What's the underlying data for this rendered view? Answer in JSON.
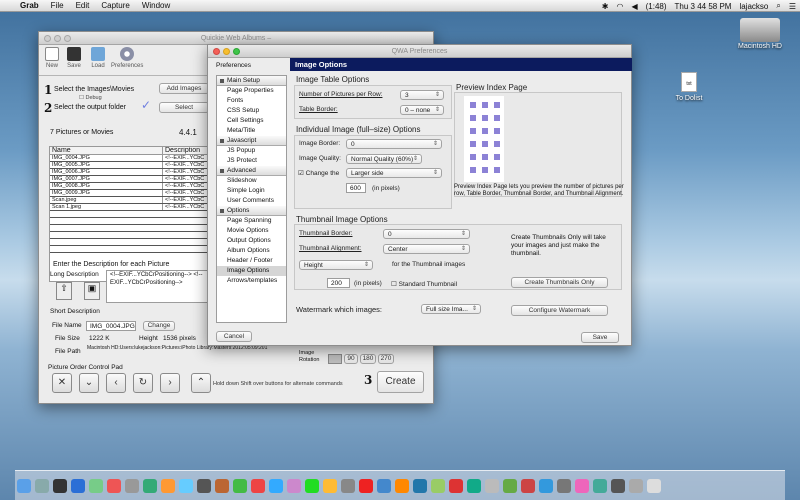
{
  "menubar": {
    "app": "Grab",
    "items": [
      "File",
      "Edit",
      "Capture",
      "Window"
    ],
    "battery": "(1:48)",
    "clock": "Thu 3 44 58 PM",
    "user": "lajackso"
  },
  "desktop": {
    "hd_label": "Macintosh HD",
    "file_ext": "txt",
    "file_label": "To Dolist"
  },
  "main": {
    "title": "Quickie Web Albums –",
    "toolbar": [
      "New",
      "Save",
      "Load",
      "Preferences"
    ],
    "step1": "Select the Images\\Movies",
    "step1_sub": "Debug",
    "add_images": "Add Images",
    "step2": "Select the output folder",
    "select_btn": "Select",
    "count": "7 Pictures or Movies",
    "version": "4.4.1",
    "table": {
      "headers": [
        "Name",
        "Description"
      ],
      "rows": [
        [
          "IMG_0004.JPG",
          "<!--EXIF...YCbC"
        ],
        [
          "IMG_0005.JPG",
          "<!--EXIF...YCbC"
        ],
        [
          "IMG_0006.JPG",
          "<!--EXIF...YCbC"
        ],
        [
          "IMG_0007.JPG",
          "<!--EXIF...YCbC"
        ],
        [
          "IMG_0008.JPG",
          "<!--EXIF...YCbC"
        ],
        [
          "IMG_0009.JPG",
          "<!--EXIF...YCbC"
        ],
        [
          "Scan.jpeg",
          "<!--EXIF...YCbC"
        ],
        [
          "Scan 1.jpeg",
          "<!--EXIF...YCbC"
        ]
      ]
    },
    "desc_header": "Enter  the Description for each Picture",
    "long_desc_label": "Long Description",
    "long_desc_value": "<!--EXIF...YCbCrPositioning-->  <!--EXIF...YCbCrPositioning-->",
    "short_desc_label": "Short Description",
    "file_name_label": "File Name",
    "file_name_value": "IMG_0004.JPG",
    "change": "Change",
    "file_size_label": "File Size",
    "file_size_value": "1222 K",
    "height_label": "Height",
    "height_value": "1536 pixels",
    "file_path_label": "File Path",
    "file_path_value": "Macintosh HD:Users:lukejackson:Pictures:iPhoto Library:Masters:2012:05:09:201",
    "image_rotation_label": "Image Rotation",
    "rotations": [
      "90",
      "180",
      "270"
    ],
    "pad_label": "Picture Order Control Pad",
    "hint": "Hold down Shift over buttons for alternate commands",
    "create_btn": "Create",
    "step3": "3"
  },
  "prefs": {
    "title": "QWA Preferences",
    "list_header": "Preferences",
    "bar": "Image Options",
    "groups": [
      {
        "h": "Main Setup",
        "items": [
          "Page Properties",
          "Fonts",
          "CSS Setup",
          "Cell Settings",
          "Meta/Title"
        ]
      },
      {
        "h": "Javascript",
        "items": [
          "JS Popup",
          "JS Protect"
        ]
      },
      {
        "h": "Advanced",
        "items": [
          "Slideshow",
          "Simple Login",
          "User Comments"
        ]
      },
      {
        "h": "Options",
        "items": [
          "Page Spanning",
          "Movie Options",
          "Output Options",
          "Album Options",
          "Header / Footer",
          "Image Options",
          "Arrows/templates"
        ]
      }
    ],
    "selected_item": "Image Options",
    "table_opts": {
      "title": "Image Table Options",
      "npr_label": "Number of Pictures per Row:",
      "npr_value": "3",
      "border_label": "Table Border:",
      "border_value": "0 – none"
    },
    "indiv": {
      "title": "Individual Image (full–size) Options",
      "border_label": "Image Border:",
      "border_value": "0",
      "quality_label": "Image Quality:",
      "quality_value": "Normal Quality (60%)",
      "change_label": "Change the",
      "change_value": "Larger side",
      "px_value": "600",
      "px_label": "(in pixels)"
    },
    "preview": {
      "title": "Preview Index Page",
      "text": "Preview Index Page lets you preview the number of pictures per row, Table Border, Thumbnail Border, and Thumbnail Alignment."
    },
    "thumb": {
      "title": "Thumbnail Image Options",
      "border_label": "Thumbnail Border:",
      "border_value": "0",
      "align_label": "Thumbnail Alignment:",
      "align_value": "Center",
      "dim_value": "Height",
      "for_label": "for the Thumbnail images",
      "px_value": "200",
      "px_label": "(in pixels)",
      "std_label": "Standard Thumbnail",
      "note": "Create Thumbnails Only  will take your images and just make the thumbnail.",
      "create_only": "Create Thumbnails Only"
    },
    "watermark": {
      "label": "Watermark which images:",
      "value": "Full size Ima...",
      "configure": "Configure Watermark"
    },
    "cancel": "Cancel",
    "save": "Save"
  }
}
